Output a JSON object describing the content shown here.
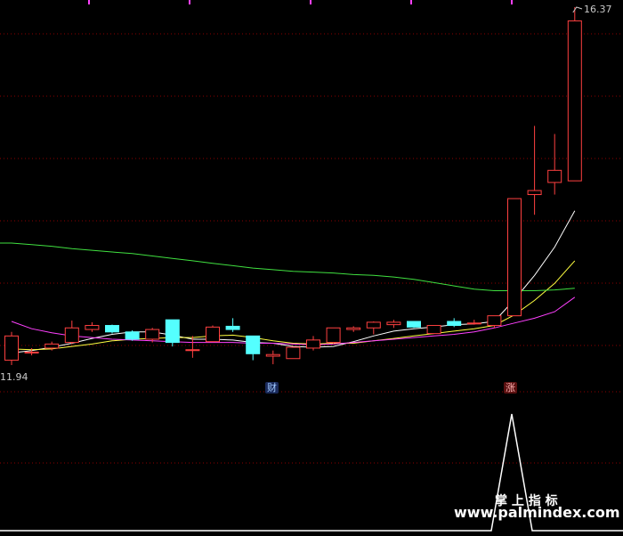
{
  "labels": {
    "high_price": "16.37",
    "low_price": "11.94",
    "badge_cai": "财",
    "badge_zhang": "涨",
    "watermark_title": "掌 上 指 标",
    "watermark_url": "www.palmindex.com"
  },
  "colors": {
    "background": "#000000",
    "grid": "#8b0000",
    "up_candle": "#ff4040",
    "down_candle": "#54ffff",
    "ma_white": "#ffffff",
    "ma_yellow": "#ffff40",
    "ma_magenta": "#ff40ff",
    "ma_green": "#40e040",
    "indicator": "#ffffff",
    "tick_marks": "#ff40ff"
  },
  "chart_data": {
    "type": "candlestick",
    "price_range": [
      11.94,
      16.37
    ],
    "candles": [
      {
        "o": 12.0,
        "h": 12.35,
        "l": 11.94,
        "c": 12.3
      },
      {
        "o": 12.1,
        "h": 12.15,
        "l": 12.06,
        "c": 12.1
      },
      {
        "o": 12.15,
        "h": 12.23,
        "l": 12.12,
        "c": 12.2
      },
      {
        "o": 12.22,
        "h": 12.49,
        "l": 12.2,
        "c": 12.4
      },
      {
        "o": 12.38,
        "h": 12.47,
        "l": 12.35,
        "c": 12.43
      },
      {
        "o": 12.43,
        "h": 12.44,
        "l": 12.33,
        "c": 12.35
      },
      {
        "o": 12.35,
        "h": 12.37,
        "l": 12.24,
        "c": 12.26
      },
      {
        "o": 12.26,
        "h": 12.4,
        "l": 12.22,
        "c": 12.38
      },
      {
        "o": 12.5,
        "h": 12.5,
        "l": 12.17,
        "c": 12.22
      },
      {
        "o": 12.12,
        "h": 12.3,
        "l": 12.03,
        "c": 12.13
      },
      {
        "o": 12.23,
        "h": 12.43,
        "l": 12.23,
        "c": 12.41
      },
      {
        "o": 12.42,
        "h": 12.52,
        "l": 12.35,
        "c": 12.38
      },
      {
        "o": 12.3,
        "h": 12.3,
        "l": 12.0,
        "c": 12.08
      },
      {
        "o": 12.05,
        "h": 12.12,
        "l": 11.95,
        "c": 12.07
      },
      {
        "o": 12.02,
        "h": 12.16,
        "l": 12.02,
        "c": 12.16
      },
      {
        "o": 12.15,
        "h": 12.3,
        "l": 12.12,
        "c": 12.25
      },
      {
        "o": 12.22,
        "h": 12.4,
        "l": 12.2,
        "c": 12.4
      },
      {
        "o": 12.38,
        "h": 12.42,
        "l": 12.35,
        "c": 12.4
      },
      {
        "o": 12.4,
        "h": 12.48,
        "l": 12.32,
        "c": 12.47
      },
      {
        "o": 12.44,
        "h": 12.5,
        "l": 12.4,
        "c": 12.47
      },
      {
        "o": 12.48,
        "h": 12.48,
        "l": 12.4,
        "c": 12.41
      },
      {
        "o": 12.33,
        "h": 12.41,
        "l": 12.33,
        "c": 12.43
      },
      {
        "o": 12.48,
        "h": 12.52,
        "l": 12.41,
        "c": 12.43
      },
      {
        "o": 12.46,
        "h": 12.5,
        "l": 12.44,
        "c": 12.46
      },
      {
        "o": 12.43,
        "h": 12.55,
        "l": 12.4,
        "c": 12.55
      },
      {
        "o": 12.55,
        "h": 14.0,
        "l": 12.55,
        "c": 14.0
      },
      {
        "o": 14.05,
        "h": 14.9,
        "l": 13.8,
        "c": 14.1
      },
      {
        "o": 14.2,
        "h": 14.8,
        "l": 14.05,
        "c": 14.35
      },
      {
        "o": 14.22,
        "h": 16.37,
        "l": 14.22,
        "c": 16.2
      }
    ],
    "ma_lines": [
      {
        "color_key": "ma_white",
        "values": [
          12.09,
          12.12,
          12.16,
          12.21,
          12.27,
          12.32,
          12.35,
          12.35,
          12.31,
          12.26,
          12.26,
          12.25,
          12.22,
          12.21,
          12.17,
          12.16,
          12.17,
          12.23,
          12.3,
          12.36,
          12.39,
          12.41,
          12.44,
          12.45,
          12.48,
          12.75,
          13.05,
          13.4,
          13.85
        ]
      },
      {
        "color_key": "ma_yellow",
        "values": [
          12.14,
          12.13,
          12.14,
          12.17,
          12.2,
          12.24,
          12.26,
          12.27,
          12.28,
          12.28,
          12.3,
          12.31,
          12.28,
          12.24,
          12.21,
          12.2,
          12.21,
          12.21,
          12.24,
          12.27,
          12.3,
          12.33,
          12.36,
          12.39,
          12.43,
          12.56,
          12.74,
          12.95,
          13.23
        ]
      },
      {
        "color_key": "ma_magenta",
        "values": [
          12.48,
          12.39,
          12.34,
          12.3,
          12.28,
          12.26,
          12.25,
          12.24,
          12.23,
          12.22,
          12.22,
          12.22,
          12.21,
          12.21,
          12.2,
          12.19,
          12.2,
          12.22,
          12.24,
          12.26,
          12.28,
          12.3,
          12.32,
          12.35,
          12.4,
          12.46,
          12.52,
          12.6,
          12.78
        ]
      },
      {
        "color_key": "ma_green",
        "values": [
          13.45,
          13.43,
          13.41,
          13.38,
          13.36,
          13.34,
          13.32,
          13.29,
          13.26,
          13.23,
          13.2,
          13.17,
          13.14,
          13.12,
          13.1,
          13.09,
          13.08,
          13.06,
          13.05,
          13.03,
          13.0,
          12.96,
          12.92,
          12.88,
          12.86,
          12.86,
          12.86,
          12.87,
          12.89
        ]
      }
    ],
    "indicator_line": [
      0,
      0,
      0,
      0,
      0,
      0,
      0,
      0,
      0,
      0,
      0,
      0,
      0,
      0,
      0,
      0,
      0,
      0,
      0,
      0,
      0,
      0,
      0,
      0,
      0,
      1,
      0
    ],
    "grid": true
  }
}
